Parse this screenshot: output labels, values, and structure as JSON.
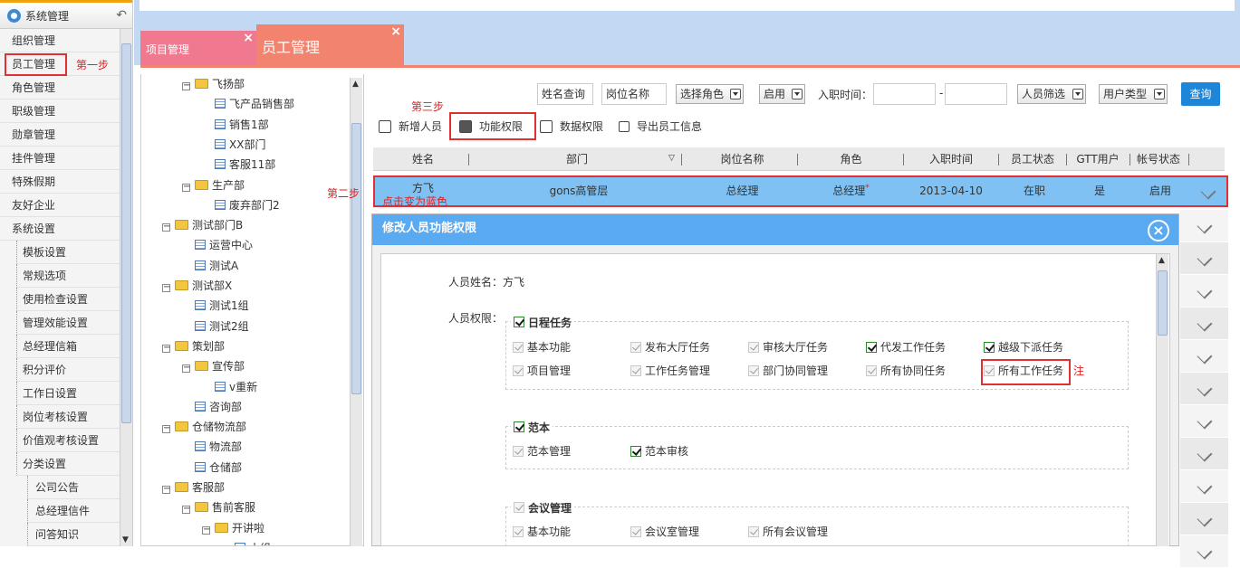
{
  "left_nav": {
    "header": "系统管理",
    "items": [
      "组织管理",
      "员工管理",
      "角色管理",
      "职级管理",
      "勋章管理",
      "挂件管理",
      "特殊假期",
      "友好企业",
      "系统设置"
    ],
    "sub_items": [
      "模板设置",
      "常规选项",
      "使用检查设置",
      "管理效能设置",
      "总经理信箱",
      "积分评价",
      "工作日设置",
      "岗位考核设置",
      "价值观考核设置",
      "分类设置"
    ],
    "sub2_items": [
      "公司公告",
      "总经理信件",
      "问答知识"
    ]
  },
  "tabs": {
    "tab1": "项目管理",
    "tab2": "员工管理"
  },
  "tree": {
    "nodes": [
      {
        "label": "飞扬部",
        "type": "folder",
        "indent": 2,
        "toggle": "−"
      },
      {
        "label": "飞产品销售部",
        "type": "doc",
        "indent": 3
      },
      {
        "label": "销售1部",
        "type": "doc",
        "indent": 3
      },
      {
        "label": "XX部门",
        "type": "doc",
        "indent": 3
      },
      {
        "label": "客服11部",
        "type": "doc",
        "indent": 3
      },
      {
        "label": "生产部",
        "type": "folder",
        "indent": 2,
        "toggle": "−"
      },
      {
        "label": "废弃部门2",
        "type": "doc",
        "indent": 3
      },
      {
        "label": "测试部门B",
        "type": "folder",
        "indent": 1,
        "toggle": "−"
      },
      {
        "label": "运营中心",
        "type": "doc",
        "indent": 2
      },
      {
        "label": "测试A",
        "type": "doc",
        "indent": 2
      },
      {
        "label": "测试部X",
        "type": "folder",
        "indent": 1,
        "toggle": "−"
      },
      {
        "label": "测试1组",
        "type": "doc",
        "indent": 2
      },
      {
        "label": "测试2组",
        "type": "doc",
        "indent": 2
      },
      {
        "label": "策划部",
        "type": "folder",
        "indent": 1,
        "toggle": "−"
      },
      {
        "label": "宣传部",
        "type": "folder",
        "indent": 2,
        "toggle": "−"
      },
      {
        "label": "v重新",
        "type": "doc",
        "indent": 3
      },
      {
        "label": "咨询部",
        "type": "doc",
        "indent": 2
      },
      {
        "label": "仓储物流部",
        "type": "folder",
        "indent": 1,
        "toggle": "−"
      },
      {
        "label": "物流部",
        "type": "doc",
        "indent": 2
      },
      {
        "label": "仓储部",
        "type": "doc",
        "indent": 2
      },
      {
        "label": "客服部",
        "type": "folder",
        "indent": 1,
        "toggle": "−"
      },
      {
        "label": "售前客服",
        "type": "folder",
        "indent": 2,
        "toggle": "−"
      },
      {
        "label": "开讲啦",
        "type": "folder",
        "indent": 3,
        "toggle": "−"
      },
      {
        "label": "小组",
        "type": "doc",
        "indent": 4
      }
    ]
  },
  "filters": {
    "name_query": "姓名查询",
    "position_name": "岗位名称",
    "select_role": "选择角色",
    "enabled": "启用",
    "join_time_label": "入职时间：",
    "dash": "-",
    "person_filter": "人员筛选",
    "user_type": "用户类型",
    "query_button": "查询"
  },
  "toolbar": {
    "add_person": "新增人员",
    "func_perm": "功能权限",
    "data_perm": "数据权限",
    "export": "导出员工信息"
  },
  "annotations": {
    "step1": "第一步",
    "step2": "第二步",
    "step3": "第三步",
    "click_blue": "点击变为蓝色",
    "note": "注"
  },
  "grid": {
    "headers": [
      "姓名",
      "部门",
      "岗位名称",
      "角色",
      "入职时间",
      "员工状态",
      "GTT用户",
      "帐号状态"
    ],
    "row": {
      "name": "方飞",
      "dept": "gons高管层",
      "position": "总经理",
      "role": "总经理",
      "role_mark": "*",
      "join": "2013-04-10",
      "status": "在职",
      "gtt": "是",
      "account": "启用"
    }
  },
  "modal": {
    "title": "修改人员功能权限",
    "close": "×",
    "name_label": "人员姓名：方飞",
    "perm_label": "人员权限：",
    "groups": [
      {
        "title": "日程任务",
        "items": [
          "基本功能",
          "发布大厅任务",
          "审核大厅任务",
          "代发工作任务",
          "越级下派任务",
          "项目管理",
          "工作任务管理",
          "部门协同管理",
          "所有协同任务",
          "所有工作任务"
        ]
      },
      {
        "title": "范本",
        "items": [
          "范本管理",
          "范本审核"
        ]
      },
      {
        "title": "会议管理",
        "items": [
          "基本功能",
          "会议室管理",
          "所有会议管理"
        ]
      }
    ]
  },
  "colors": {
    "accent": "#1d86d8",
    "selected_row": "#7fc1f3",
    "tab_pink": "#f1798f",
    "tab_coral": "#f2836f",
    "modal_header": "#5aaaf1",
    "annotation_red": "#e03030"
  }
}
